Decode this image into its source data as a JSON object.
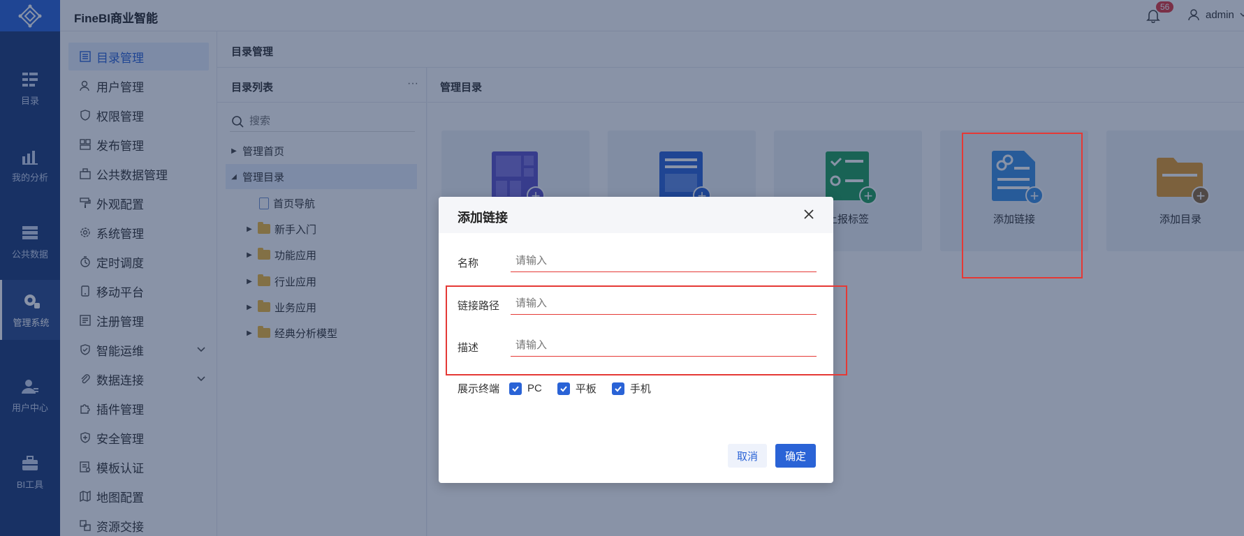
{
  "app": {
    "title": "FineBI商业智能"
  },
  "header": {
    "notification_count": "56",
    "username": "admin"
  },
  "leftnav": [
    {
      "label": "目录",
      "icon": "catalog-icon"
    },
    {
      "label": "我的分析",
      "icon": "analysis-icon"
    },
    {
      "label": "公共数据",
      "icon": "public-data-icon"
    },
    {
      "label": "管理系统",
      "icon": "gear-icon",
      "active": true
    },
    {
      "label": "用户中心",
      "icon": "user-center-icon"
    },
    {
      "label": "BI工具",
      "icon": "toolbox-icon"
    }
  ],
  "menu": [
    {
      "label": "目录管理",
      "active": true
    },
    {
      "label": "用户管理"
    },
    {
      "label": "权限管理"
    },
    {
      "label": "发布管理"
    },
    {
      "label": "公共数据管理"
    },
    {
      "label": "外观配置"
    },
    {
      "label": "系统管理"
    },
    {
      "label": "定时调度"
    },
    {
      "label": "移动平台"
    },
    {
      "label": "注册管理"
    },
    {
      "label": "智能运维",
      "expandable": true
    },
    {
      "label": "数据连接",
      "expandable": true
    },
    {
      "label": "插件管理"
    },
    {
      "label": "安全管理"
    },
    {
      "label": "模板认证"
    },
    {
      "label": "地图配置"
    },
    {
      "label": "资源交接"
    }
  ],
  "content": {
    "title": "目录管理"
  },
  "dirlist": {
    "title": "目录列表",
    "more": "···",
    "search_placeholder": "搜索",
    "tree": [
      {
        "label": "管理首页"
      },
      {
        "label": "管理目录"
      },
      {
        "label": "首页导航"
      },
      {
        "label": "新手入门"
      },
      {
        "label": "功能应用"
      },
      {
        "label": "行业应用"
      },
      {
        "label": "业务应用"
      },
      {
        "label": "经典分析模型"
      }
    ]
  },
  "manage": {
    "title": "管理目录",
    "cards": [
      {
        "label": ""
      },
      {
        "label": ""
      },
      {
        "label": "上报标签"
      },
      {
        "label": "添加链接"
      },
      {
        "label": "添加目录"
      }
    ]
  },
  "dialog": {
    "title": "添加链接",
    "fields": [
      {
        "label": "名称",
        "placeholder": "请输入"
      },
      {
        "label": "链接路径",
        "placeholder": "请输入"
      },
      {
        "label": "描述",
        "placeholder": "请输入"
      }
    ],
    "terminals_label": "展示终端",
    "terminals": [
      {
        "label": "PC",
        "checked": true
      },
      {
        "label": "平板",
        "checked": true
      },
      {
        "label": "手机",
        "checked": true
      }
    ],
    "cancel": "取消",
    "confirm": "确定"
  },
  "colors": {
    "brand": "#2a63d6",
    "nav_bg": "#1c3a78",
    "highlight": "#e53935"
  }
}
